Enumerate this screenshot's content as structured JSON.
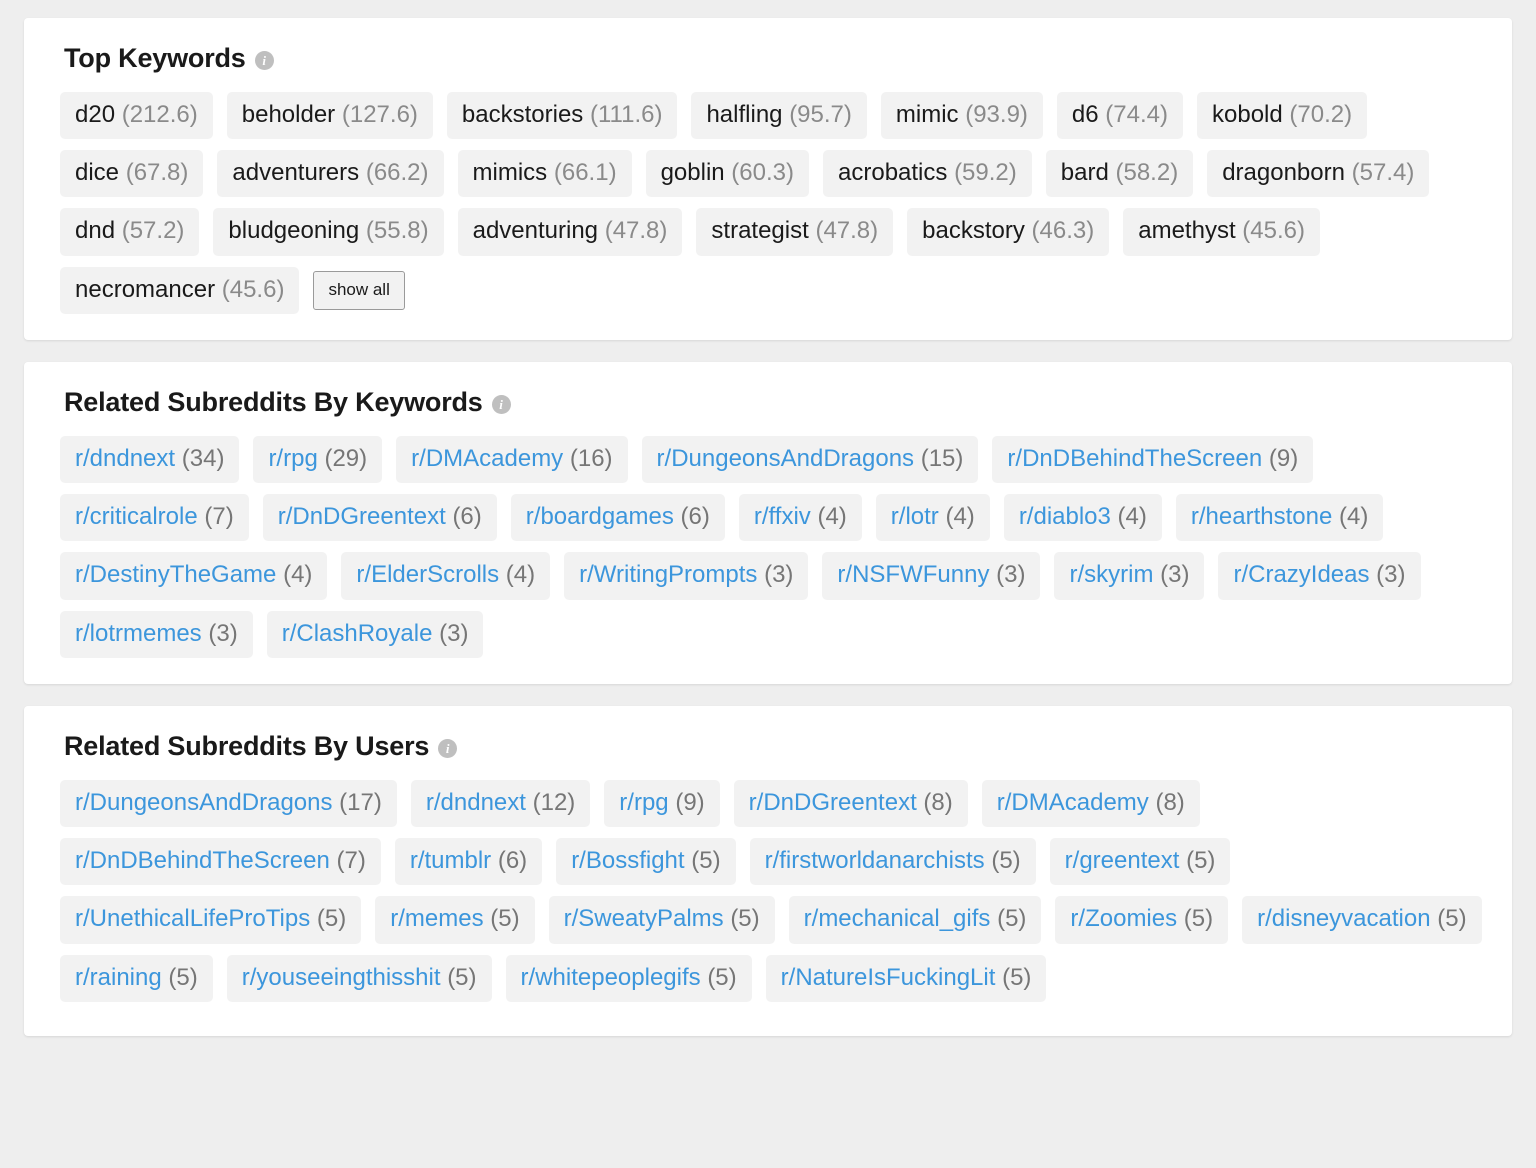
{
  "theme": {
    "page_background": "#eeeeee",
    "card_background": "#ffffff",
    "chip_background": "#f2f2f2",
    "link_color": "#3c96dc",
    "count_color": "#8a8a8a",
    "title_color": "#1a1a1a"
  },
  "cards": [
    {
      "id": "top-keywords",
      "title": "Top Keywords",
      "info_icon": "info-icon",
      "chip_type": "keyword",
      "show_all_label": "show all",
      "items": [
        {
          "name": "d20",
          "count": "(212.6)"
        },
        {
          "name": "beholder",
          "count": "(127.6)"
        },
        {
          "name": "backstories",
          "count": "(111.6)"
        },
        {
          "name": "halfling",
          "count": "(95.7)"
        },
        {
          "name": "mimic",
          "count": "(93.9)"
        },
        {
          "name": "d6",
          "count": "(74.4)"
        },
        {
          "name": "kobold",
          "count": "(70.2)"
        },
        {
          "name": "dice",
          "count": "(67.8)"
        },
        {
          "name": "adventurers",
          "count": "(66.2)"
        },
        {
          "name": "mimics",
          "count": "(66.1)"
        },
        {
          "name": "goblin",
          "count": "(60.3)"
        },
        {
          "name": "acrobatics",
          "count": "(59.2)"
        },
        {
          "name": "bard",
          "count": "(58.2)"
        },
        {
          "name": "dragonborn",
          "count": "(57.4)"
        },
        {
          "name": "dnd",
          "count": "(57.2)"
        },
        {
          "name": "bludgeoning",
          "count": "(55.8)"
        },
        {
          "name": "adventuring",
          "count": "(47.8)"
        },
        {
          "name": "strategist",
          "count": "(47.8)"
        },
        {
          "name": "backstory",
          "count": "(46.3)"
        },
        {
          "name": "amethyst",
          "count": "(45.6)"
        },
        {
          "name": "necromancer",
          "count": "(45.6)"
        }
      ]
    },
    {
      "id": "related-subreddits-by-keywords",
      "title": "Related Subreddits By Keywords",
      "info_icon": "info-icon",
      "chip_type": "link",
      "items": [
        {
          "name": "r/dndnext",
          "count": "(34)"
        },
        {
          "name": "r/rpg",
          "count": "(29)"
        },
        {
          "name": "r/DMAcademy",
          "count": "(16)"
        },
        {
          "name": "r/DungeonsAndDragons",
          "count": "(15)"
        },
        {
          "name": "r/DnDBehindTheScreen",
          "count": "(9)"
        },
        {
          "name": "r/criticalrole",
          "count": "(7)"
        },
        {
          "name": "r/DnDGreentext",
          "count": "(6)"
        },
        {
          "name": "r/boardgames",
          "count": "(6)"
        },
        {
          "name": "r/ffxiv",
          "count": "(4)"
        },
        {
          "name": "r/lotr",
          "count": "(4)"
        },
        {
          "name": "r/diablo3",
          "count": "(4)"
        },
        {
          "name": "r/hearthstone",
          "count": "(4)"
        },
        {
          "name": "r/DestinyTheGame",
          "count": "(4)"
        },
        {
          "name": "r/ElderScrolls",
          "count": "(4)"
        },
        {
          "name": "r/WritingPrompts",
          "count": "(3)"
        },
        {
          "name": "r/NSFWFunny",
          "count": "(3)"
        },
        {
          "name": "r/skyrim",
          "count": "(3)"
        },
        {
          "name": "r/CrazyIdeas",
          "count": "(3)"
        },
        {
          "name": "r/lotrmemes",
          "count": "(3)"
        },
        {
          "name": "r/ClashRoyale",
          "count": "(3)"
        }
      ]
    },
    {
      "id": "related-subreddits-by-users",
      "title": "Related Subreddits By Users",
      "info_icon": "info-icon",
      "chip_type": "link",
      "items": [
        {
          "name": "r/DungeonsAndDragons",
          "count": "(17)"
        },
        {
          "name": "r/dndnext",
          "count": "(12)"
        },
        {
          "name": "r/rpg",
          "count": "(9)"
        },
        {
          "name": "r/DnDGreentext",
          "count": "(8)"
        },
        {
          "name": "r/DMAcademy",
          "count": "(8)"
        },
        {
          "name": "r/DnDBehindTheScreen",
          "count": "(7)"
        },
        {
          "name": "r/tumblr",
          "count": "(6)"
        },
        {
          "name": "r/Bossfight",
          "count": "(5)"
        },
        {
          "name": "r/firstworldanarchists",
          "count": "(5)"
        },
        {
          "name": "r/greentext",
          "count": "(5)"
        },
        {
          "name": "r/UnethicalLifeProTips",
          "count": "(5)"
        },
        {
          "name": "r/memes",
          "count": "(5)"
        },
        {
          "name": "r/SweatyPalms",
          "count": "(5)"
        },
        {
          "name": "r/mechanical_gifs",
          "count": "(5)"
        },
        {
          "name": "r/Zoomies",
          "count": "(5)"
        },
        {
          "name": "r/disneyvacation",
          "count": "(5)"
        },
        {
          "name": "r/raining",
          "count": "(5)"
        },
        {
          "name": "r/youseeingthisshit",
          "count": "(5)"
        },
        {
          "name": "r/whitepeoplegifs",
          "count": "(5)"
        },
        {
          "name": "r/NatureIsFuckingLit",
          "count": "(5)"
        }
      ]
    }
  ]
}
